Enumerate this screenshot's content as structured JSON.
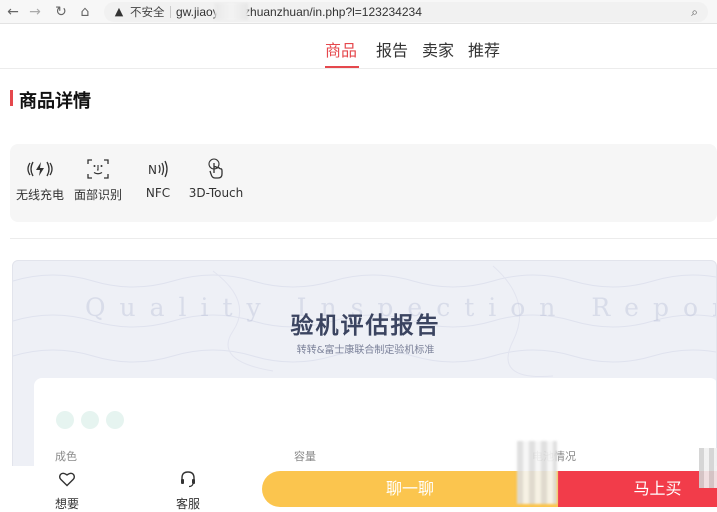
{
  "browser": {
    "security_label": "不安全",
    "url": "gw.jiaoy      .icu/zhuanzhuan/in.php?l=123234234"
  },
  "tabs": [
    {
      "label": "商品",
      "active": true
    },
    {
      "label": "报告",
      "active": false
    },
    {
      "label": "卖家",
      "active": false
    },
    {
      "label": "推荐",
      "active": false
    }
  ],
  "section": {
    "title": "商品详情"
  },
  "features": [
    {
      "icon": "wireless-charging-icon",
      "label": "无线充电"
    },
    {
      "icon": "face-id-icon",
      "label": "面部识别"
    },
    {
      "icon": "nfc-icon",
      "label": "NFC"
    },
    {
      "icon": "3d-touch-icon",
      "label": "3D-Touch"
    }
  ],
  "report": {
    "watermark": "Quality Inspection Report",
    "title": "验机评估报告",
    "subtitle": "转转&富士康联合制定验机标准",
    "columns": [
      "成色",
      "容量",
      "电池情况"
    ]
  },
  "bottom": {
    "favorite_label": "想要",
    "service_label": "客服",
    "chat_label": "聊一聊",
    "buy_label": "马上买"
  },
  "colors": {
    "accent": "#e5484d",
    "chat": "#fbc54e",
    "buy": "#f23c4a"
  }
}
